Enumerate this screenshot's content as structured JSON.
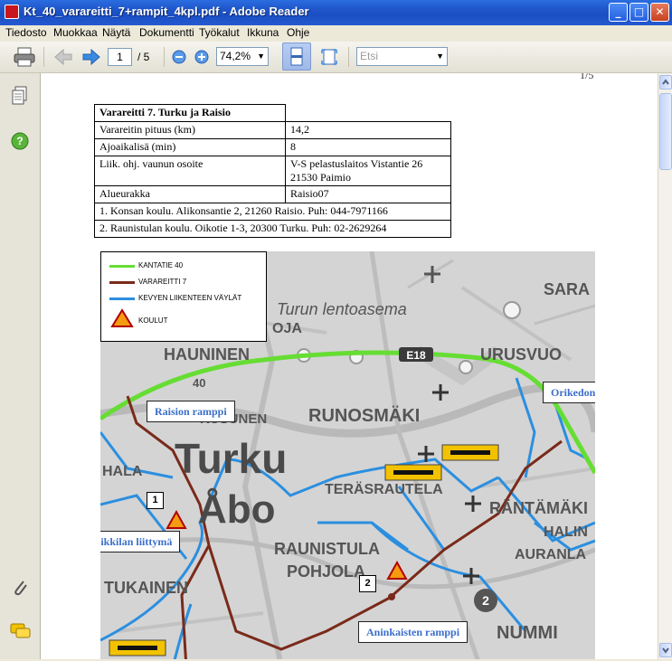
{
  "window": {
    "title": "Kt_40_varareitti_7+rampit_4kpl.pdf - Adobe Reader",
    "minimize": "_",
    "maximize": "□",
    "close": "✕"
  },
  "menu": [
    "Tiedosto",
    "Muokkaa",
    "Näytä",
    "Dokumentti",
    "Työkalut",
    "Ikkuna",
    "Ohje"
  ],
  "toolbar": {
    "page_value": "1",
    "page_total": "/ 5",
    "zoom_value": "74,2%",
    "search_placeholder": "Etsi"
  },
  "document": {
    "page_number": "1/5",
    "table": {
      "title": "Varareitti 7. Turku ja Raisio",
      "rows": [
        {
          "label": "Varareitin pituus (km)",
          "value": "14,2"
        },
        {
          "label": "Ajoaikalisä (min)",
          "value": "8"
        },
        {
          "label": "Liik. ohj. vaunun osoite",
          "value": "V-S pelastuslaitos Vistantie 26",
          "value2": "21530 Paimio"
        },
        {
          "label": "Alueurakka",
          "value": "Raisio07"
        }
      ],
      "schools": [
        "1. Konsan koulu. Alikonsantie 2, 21260 Raisio. Puh: 044-7971166",
        "2. Raunistulan koulu. Oikotie 1-3, 20300 Turku. Puh: 02-2629264"
      ]
    },
    "map": {
      "legend": [
        "KANTATIE 40",
        "VARAREITTI 7",
        "KEVYEN LIIKENTEEN VÄYLÄT",
        "KOULUT"
      ],
      "callouts": [
        "Raision ramppi",
        "Orikedon ramppi",
        "Suikkilan liittymä",
        "Aninkaisten ramppi"
      ],
      "school_markers": [
        "1",
        "2"
      ],
      "place_names": [
        "Turun lentoasema",
        "SARA",
        "HAUNINEN",
        "URUSVUO",
        "RUNOSMÄKI",
        "Turku",
        "Åbo",
        "HALA",
        "TERÄSRAUTELA",
        "RÄNTÄMÄKI",
        "HALIN",
        "AURANLA",
        "RAUNISTULA",
        "POHJOLA",
        "TUKAINEN",
        "NUMMI",
        "OJA",
        "KUSUNEN",
        "40",
        "E18",
        "2"
      ],
      "colors": {
        "kantatie": "#66dd33",
        "varareitti": "#7a2a1a",
        "kevyt": "#2b8fe0"
      }
    }
  }
}
